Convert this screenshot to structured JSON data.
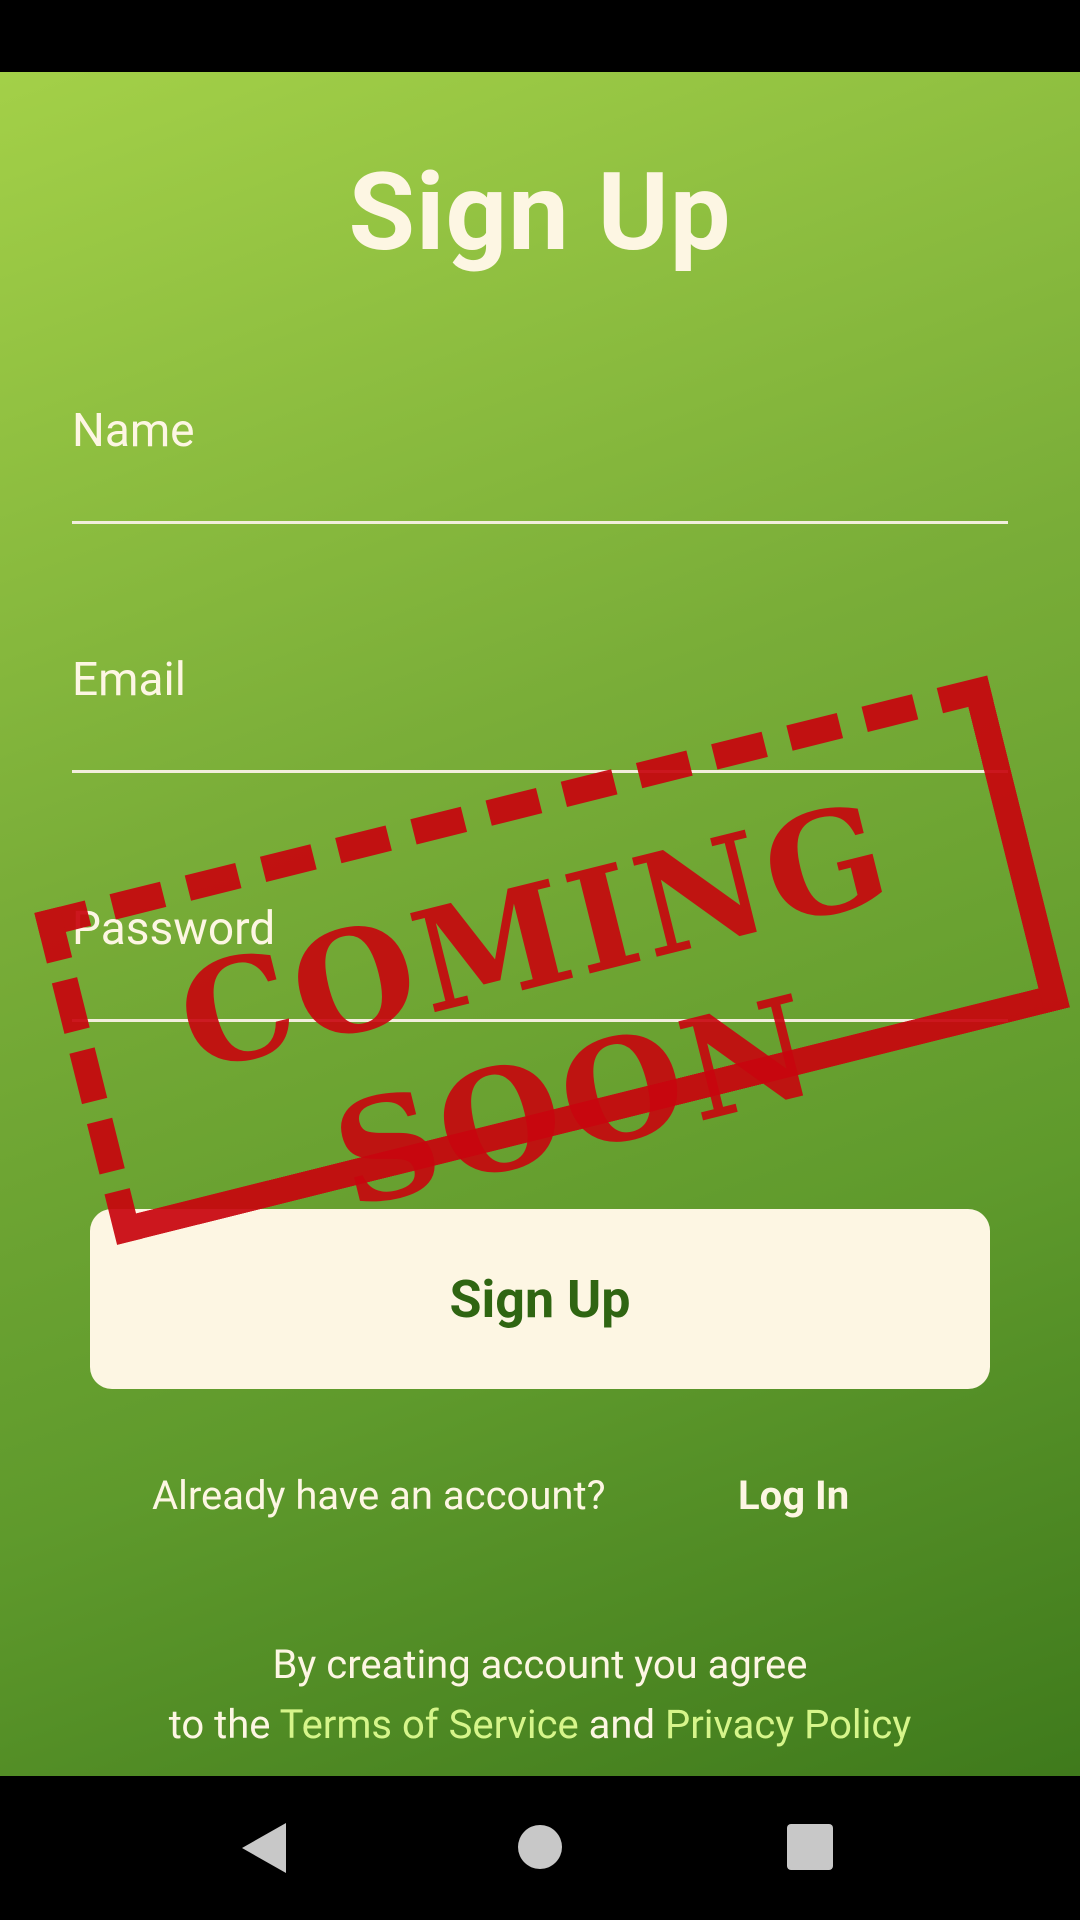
{
  "screen": {
    "title": "Sign Up"
  },
  "form": {
    "name_label": "Name",
    "email_label": "Email",
    "password_label": "Password",
    "submit_label": "Sign Up"
  },
  "login_prompt": {
    "text": "Already have an account?",
    "link": "Log In"
  },
  "terms": {
    "line1": "By creating account you agree",
    "prefix": "to the",
    "tos": "Terms of Service",
    "and": "and",
    "privacy": "Privacy Policy"
  },
  "stamp": {
    "text": "COMING SOON",
    "color": "#c8050e"
  },
  "colors": {
    "primary_text": "#fdf6e3",
    "button_text": "#2f6512",
    "link": "#d6f58a"
  },
  "nav": {
    "icons": [
      "back-icon",
      "home-icon",
      "recents-icon"
    ]
  }
}
